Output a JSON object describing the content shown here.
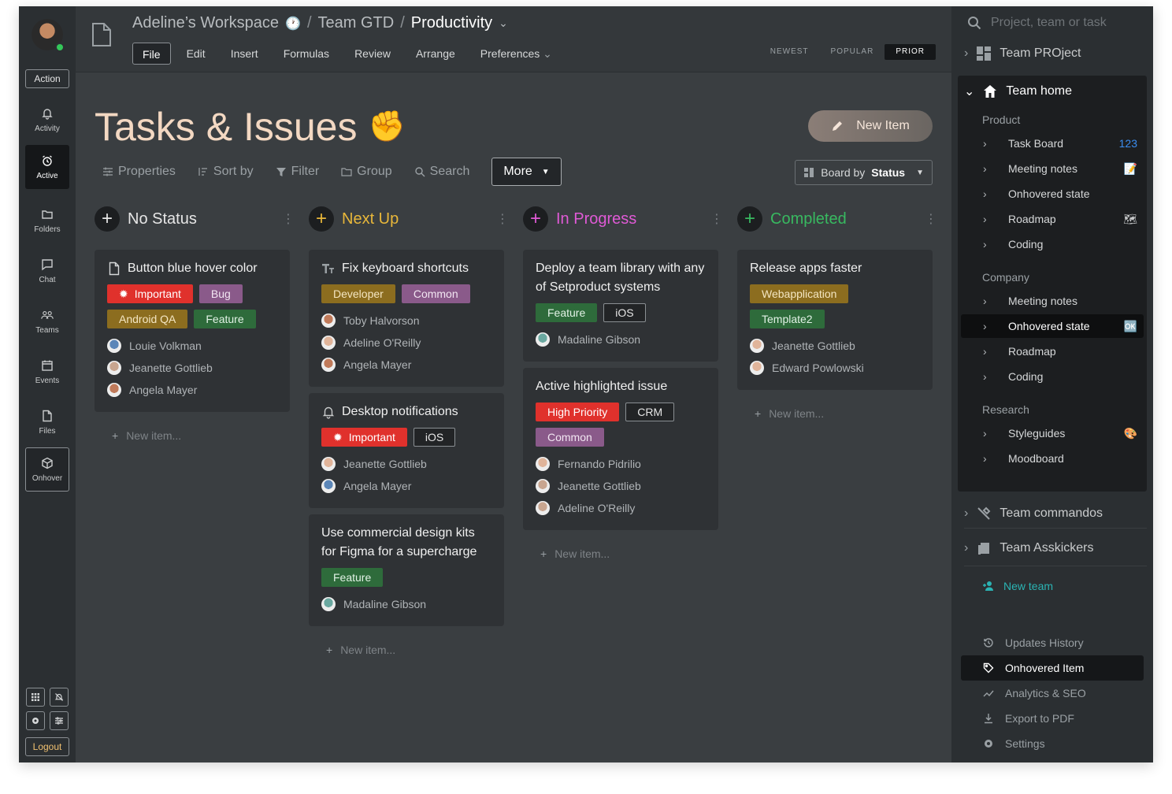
{
  "rail": {
    "action_label": "Action",
    "items": [
      {
        "label": "Activity",
        "icon": "bell-icon"
      },
      {
        "label": "Active",
        "icon": "alarm-clock-icon"
      },
      {
        "label": "Folders",
        "icon": "folder-icon"
      },
      {
        "label": "Chat",
        "icon": "chat-icon"
      },
      {
        "label": "Teams",
        "icon": "teams-icon"
      },
      {
        "label": "Events",
        "icon": "calendar-icon"
      },
      {
        "label": "Files",
        "icon": "file-icon"
      },
      {
        "label": "Onhover",
        "icon": "cube-icon"
      }
    ],
    "logout_label": "Logout"
  },
  "topbar": {
    "breadcrumb": [
      "Adeline’s Workspace",
      "Team GTD",
      "Productivity"
    ],
    "menu": [
      "File",
      "Edit",
      "Insert",
      "Formulas",
      "Review",
      "Arrange",
      "Preferences"
    ],
    "selected_menu": "File",
    "sort_tabs": [
      "NEWEST",
      "POPULAR",
      "PRIOR"
    ],
    "selected_sort": "PRIOR"
  },
  "main": {
    "title": "Tasks & Issues",
    "new_item_label": "New Item",
    "toolbar": [
      "Properties",
      "Sort by",
      "Filter",
      "Group",
      "Search"
    ],
    "more_label": "More",
    "board_prefix": "Board by",
    "board_value": "Status"
  },
  "columns": [
    {
      "title": "No Status",
      "color": "#e6e6e6",
      "new_item": "New item...",
      "cards": [
        {
          "title": "Button blue hover color",
          "icon": "file-icon",
          "tags": [
            {
              "label": "Important",
              "style": "red",
              "icon": "alarm"
            },
            {
              "label": "Bug",
              "style": "purple"
            },
            {
              "label": "Android QA",
              "style": "olive"
            },
            {
              "label": "Feature",
              "style": "green"
            }
          ],
          "people": [
            "Louie Volkman",
            "Jeanette Gottlieb",
            "Angela Mayer"
          ]
        }
      ]
    },
    {
      "title": "Next Up",
      "color": "#e8b73a",
      "new_item": "New item...",
      "cards": [
        {
          "title": "Fix keyboard shortcuts",
          "icon": "text-icon",
          "tags": [
            {
              "label": "Developer",
              "style": "olive"
            },
            {
              "label": "Common",
              "style": "purple"
            }
          ],
          "people": [
            "Toby Halvorson",
            "Adeline O'Reilly",
            "Angela Mayer"
          ]
        },
        {
          "title": "Desktop notifications",
          "icon": "bell-icon",
          "tags": [
            {
              "label": "Important",
              "style": "red",
              "icon": "alarm"
            },
            {
              "label": "iOS",
              "style": "dark"
            }
          ],
          "people": [
            "Jeanette Gottlieb",
            "Angela Mayer"
          ]
        },
        {
          "title": "Use commercial design kits for Figma for a supercharge",
          "icon": "",
          "tags": [
            {
              "label": "Feature",
              "style": "green"
            }
          ],
          "people": [
            "Madaline Gibson"
          ]
        }
      ]
    },
    {
      "title": "In Progress",
      "color": "#e05ad6",
      "new_item": "New item...",
      "cards": [
        {
          "title": "Deploy a team library with any of Setproduct systems",
          "icon": "",
          "tags": [
            {
              "label": "Feature",
              "style": "green"
            },
            {
              "label": "iOS",
              "style": "dark"
            }
          ],
          "people": [
            "Madaline Gibson"
          ]
        },
        {
          "title": "Active highlighted issue",
          "icon": "",
          "tags": [
            {
              "label": "High Priority",
              "style": "red"
            },
            {
              "label": "CRM",
              "style": "dark"
            },
            {
              "label": "Common",
              "style": "purple"
            }
          ],
          "people": [
            "Fernando Pidrilio",
            "Jeanette Gottlieb",
            "Adeline O'Reilly"
          ]
        }
      ]
    },
    {
      "title": "Completed",
      "color": "#38b960",
      "new_item": "New item...",
      "cards": [
        {
          "title": "Release apps faster",
          "icon": "",
          "tags": [
            {
              "label": "Webapplication",
              "style": "olive"
            },
            {
              "label": "Template2",
              "style": "green"
            }
          ],
          "people": [
            "Jeanette Gottlieb",
            "Edward Powlowski"
          ]
        }
      ]
    }
  ],
  "sidebar": {
    "search_placeholder": "Project, team or task",
    "team_project": "Team PROject",
    "team_home": "Team home",
    "groups": [
      {
        "name": "Product",
        "items": [
          {
            "label": "Task Board",
            "meta": "123"
          },
          {
            "label": "Meeting notes",
            "meta": "📝"
          },
          {
            "label": "Onhovered state",
            "meta": ""
          },
          {
            "label": "Roadmap",
            "meta": "🗺"
          },
          {
            "label": "Coding",
            "meta": ""
          }
        ]
      },
      {
        "name": "Company",
        "items": [
          {
            "label": "Meeting notes",
            "meta": ""
          },
          {
            "label": "Onhovered state",
            "meta": "🆗"
          },
          {
            "label": "Roadmap",
            "meta": ""
          },
          {
            "label": "Coding",
            "meta": ""
          }
        ]
      },
      {
        "name": "Research",
        "items": [
          {
            "label": "Styleguides",
            "meta": "🎨"
          },
          {
            "label": "Moodboard",
            "meta": ""
          }
        ]
      }
    ],
    "team_commandos": "Team commandos",
    "team_asskickers": "Team Asskickers",
    "new_team": "New team",
    "footer": [
      "Updates History",
      "Onhovered Item",
      "Analytics & SEO",
      "Export to PDF",
      "Settings"
    ]
  }
}
